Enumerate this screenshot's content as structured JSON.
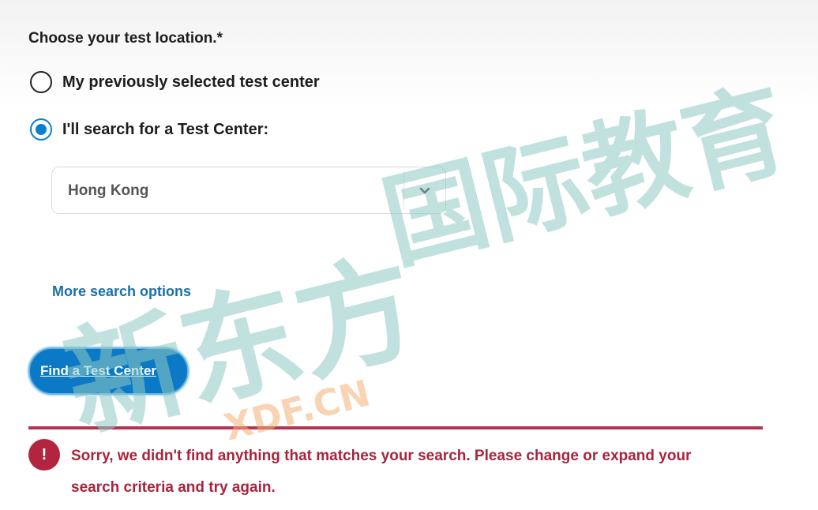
{
  "form": {
    "question": "Choose your test location.*",
    "options": [
      {
        "label": "My previously selected test center",
        "checked": false
      },
      {
        "label": "I'll search for a Test Center:",
        "checked": true
      }
    ],
    "location_select": {
      "value": "Hong Kong",
      "icon": "chevron-down-icon"
    },
    "more_link": "More search options",
    "find_button": "Find a Test Center"
  },
  "error": {
    "icon": "!",
    "message": "Sorry, we didn't find anything that matches your search. Please change or expand your search criteria and try again."
  },
  "watermark": {
    "brand": "新东方",
    "tagline": "国际教育",
    "domain": "XDF.CN"
  },
  "colors": {
    "accent": "#0b79c6",
    "link": "#1a6fa8",
    "error": "#a8243e",
    "watermark_teal": "#8fc9c4",
    "watermark_orange": "#f3b27a"
  }
}
